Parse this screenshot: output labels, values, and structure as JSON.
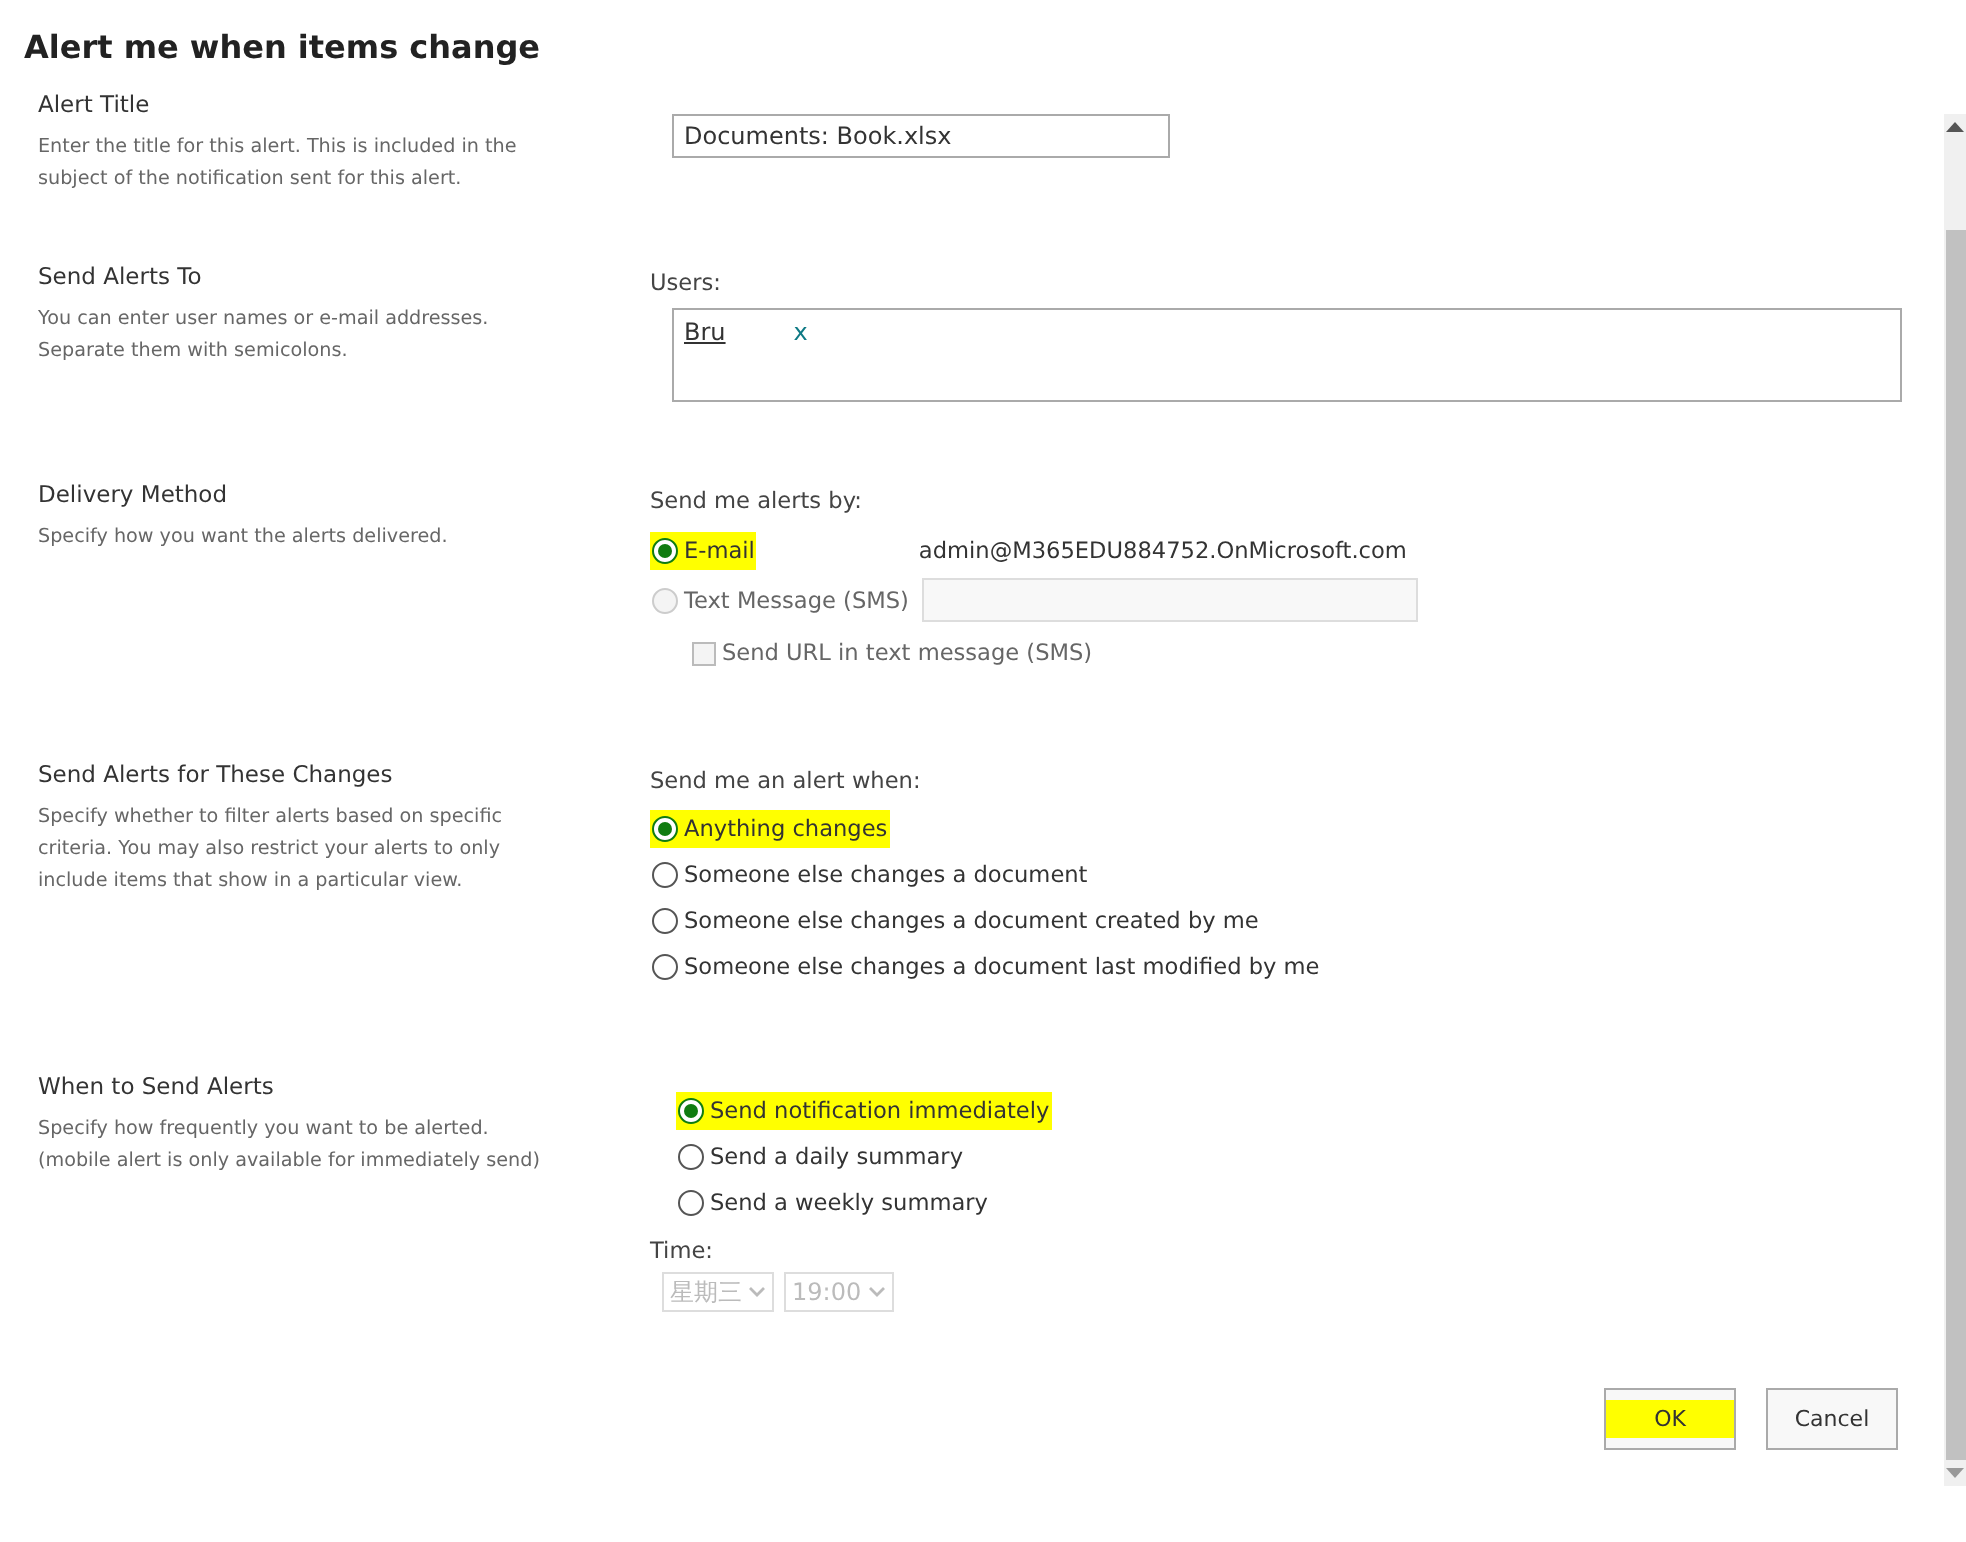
{
  "title": "Alert me when items change",
  "sections": [
    {
      "heading": "Alert Title",
      "description": "Enter the title for this alert. This is included in the subject of the notification sent for this alert.",
      "kind": "title",
      "value": "Documents: Book.xlsx"
    },
    {
      "heading": "Send Alerts To",
      "description": "You can enter user names or e-mail addresses. Separate them with semicolons.",
      "kind": "users",
      "label": "Users:",
      "user": "Bru",
      "remove": "x"
    },
    {
      "heading": "Delivery Method",
      "description": "Specify how you want the alerts delivered.",
      "kind": "delivery",
      "label": "Send me alerts by:",
      "options": [
        {
          "label": "E-mail",
          "selected": true,
          "disabled": false,
          "highlighted": true,
          "detail": "admin@M365EDU884752.OnMicrosoft.com"
        },
        {
          "label": "Text Message (SMS)",
          "selected": false,
          "disabled": true,
          "highlighted": false
        }
      ],
      "checkbox": {
        "label": "Send URL in text message (SMS)",
        "checked": false,
        "disabled": true
      }
    },
    {
      "heading": "Send Alerts for These Changes",
      "description": "Specify whether to filter alerts based on specific criteria. You may also restrict your alerts to only include items that show in a particular view.",
      "kind": "changes",
      "label": "Send me an alert when:",
      "options": [
        {
          "label": "Anything changes",
          "selected": true,
          "highlighted": true
        },
        {
          "label": "Someone else changes a document",
          "selected": false,
          "highlighted": false
        },
        {
          "label": "Someone else changes a document created by me",
          "selected": false,
          "highlighted": false
        },
        {
          "label": "Someone else changes a document last modified by me",
          "selected": false,
          "highlighted": false
        }
      ]
    },
    {
      "heading": "When to Send Alerts",
      "description": "Specify how frequently you want to be alerted. (mobile alert is only available for immediately send)",
      "kind": "when",
      "options": [
        {
          "label": "Send notification immediately",
          "selected": true,
          "highlighted": true
        },
        {
          "label": "Send a daily summary",
          "selected": false,
          "highlighted": false
        },
        {
          "label": "Send a weekly summary",
          "selected": false,
          "highlighted": false
        }
      ],
      "time_label": "Time:",
      "day": "星期三",
      "hour": "19:00",
      "time_disabled": true
    }
  ],
  "buttons": [
    {
      "label": "OK",
      "highlighted": true
    },
    {
      "label": "Cancel",
      "highlighted": false
    }
  ]
}
